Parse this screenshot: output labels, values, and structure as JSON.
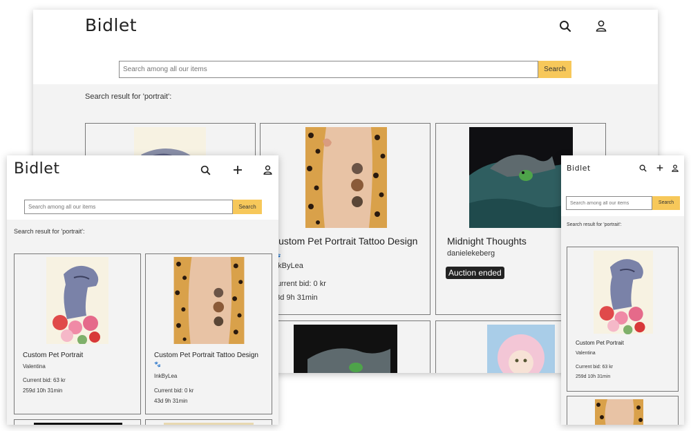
{
  "brand": "Bidlet",
  "search": {
    "placeholder": "Search among all our items",
    "button_label": "Search"
  },
  "results_label": "Search result for 'portrait':",
  "listings": [
    {
      "title": "Custom Pet Portrait",
      "seller": "Valentina",
      "bid": "Current bid: 63 kr",
      "time_left": "259d 10h 31min",
      "image": "watercolor-dog-flowers-image"
    },
    {
      "title": "Custom Pet Portrait Tattoo Design",
      "seller_icon": "🐾",
      "seller": "InkByLea",
      "bid": "Current bid: 0 kr",
      "time_left": "43d 9h 31min",
      "image": "pet-tattoo-leg-image"
    },
    {
      "title": "Midnight Thoughts",
      "seller": "danielekeberg",
      "status": "Auction ended",
      "image": "frog-under-blanket-image"
    },
    {
      "title": "",
      "image": "doll-with-lace-bonnet-image"
    }
  ],
  "colors": {
    "accent": "#f7c85a",
    "page_gray": "#f3f3f3",
    "badge": "#222222"
  }
}
